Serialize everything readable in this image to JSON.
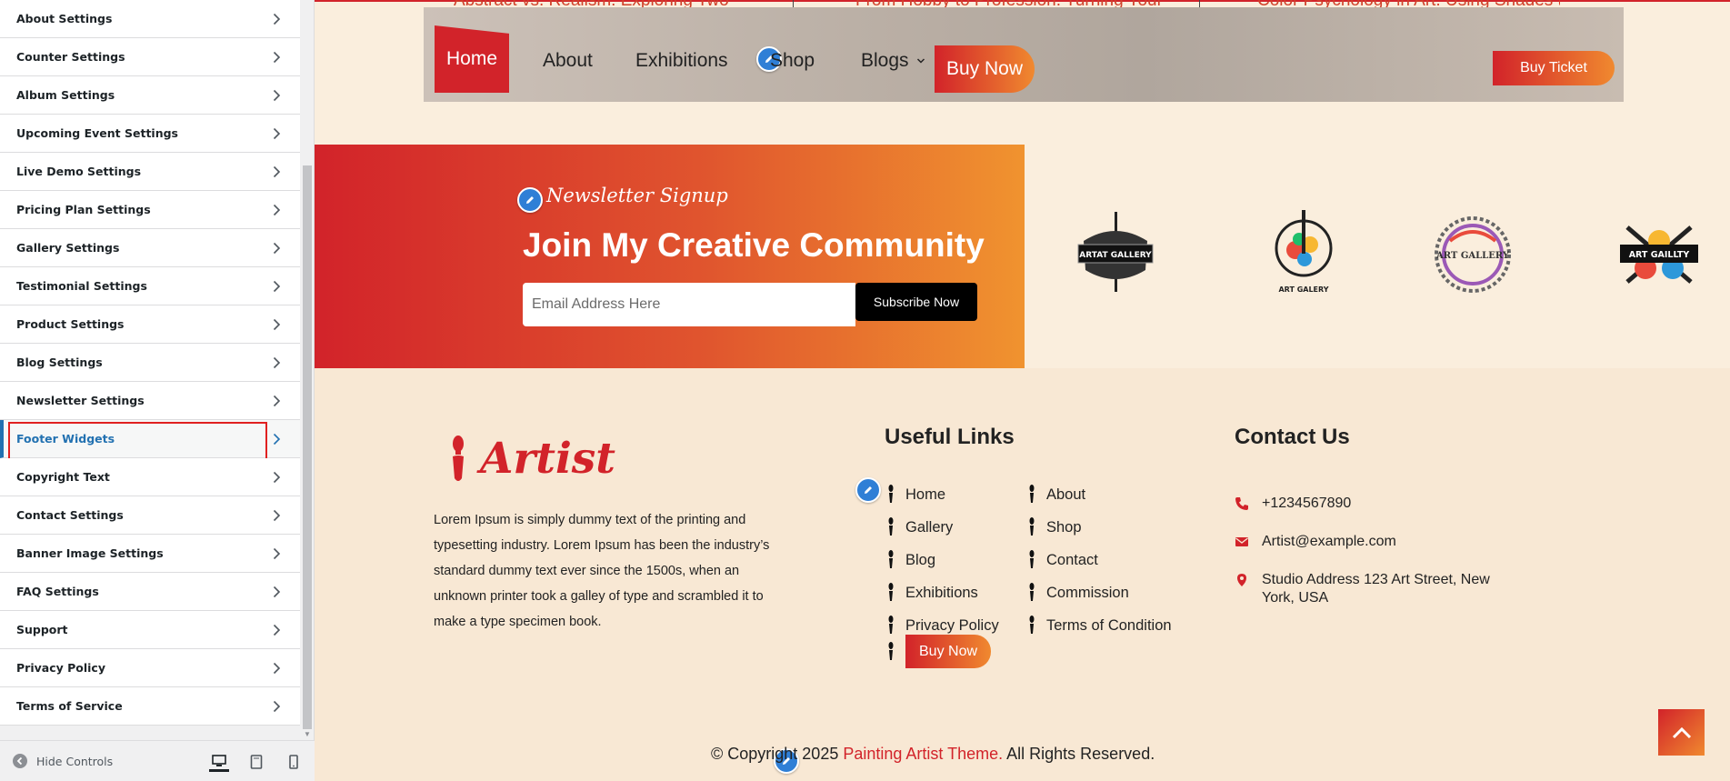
{
  "sidebar": {
    "items": [
      {
        "label": "About Settings"
      },
      {
        "label": "Counter Settings"
      },
      {
        "label": "Album Settings"
      },
      {
        "label": "Upcoming Event Settings"
      },
      {
        "label": "Live Demo Settings"
      },
      {
        "label": "Pricing Plan Settings"
      },
      {
        "label": "Gallery Settings"
      },
      {
        "label": "Testimonial Settings"
      },
      {
        "label": "Product Settings"
      },
      {
        "label": "Blog Settings"
      },
      {
        "label": "Newsletter Settings"
      },
      {
        "label": "Footer Widgets"
      },
      {
        "label": "Copyright Text"
      },
      {
        "label": "Contact Settings"
      },
      {
        "label": "Banner Image Settings"
      },
      {
        "label": "FAQ Settings"
      },
      {
        "label": "Support"
      },
      {
        "label": "Privacy Policy"
      },
      {
        "label": "Terms of Service"
      }
    ],
    "active_item": "Footer Widgets",
    "hide_controls": "Hide Controls",
    "devices": [
      "desktop-icon",
      "tablet-icon",
      "mobile-icon"
    ],
    "accent": "#2271b1"
  },
  "preview": {
    "cut_titles": [
      "Abstract vs. Realism: Exploring Two",
      "From Hobby to Profession: Turning Your",
      "Color Psychology in Art: Using Shades to"
    ],
    "nav": {
      "home": "Home",
      "about": "About",
      "exhibitions": "Exhibitions",
      "shop": "Shop",
      "blogs": "Blogs",
      "buy_now": "Buy Now",
      "buy_ticket": "Buy Ticket"
    },
    "newsletter": {
      "small_title": "Newsletter Signup",
      "title": "Join My Creative Community",
      "email_placeholder": "Email Address Here",
      "subscribe": "Subscribe Now"
    },
    "logos": [
      {
        "text": "ARTAT GALLERY"
      },
      {
        "text": "ART GALERY"
      },
      {
        "text": "ART GALLERY"
      },
      {
        "text": "ART GAILLTY"
      }
    ],
    "footer": {
      "brand": "Artist",
      "description": "Lorem Ipsum is simply dummy text of the printing and typesetting industry. Lorem Ipsum has been the industry’s standard dummy text ever since the 1500s, when an unknown printer took a galley of type and scrambled it to make a type specimen book.",
      "useful_links_heading": "Useful Links",
      "links_left": [
        "Home",
        "Gallery",
        "Blog",
        "Exhibitions",
        "Privacy Policy"
      ],
      "links_right": [
        "About",
        "Shop",
        "Contact",
        "Commission",
        "Terms of Condition"
      ],
      "buy_now": "Buy Now",
      "contact_heading": "Contact Us",
      "phone": "+1234567890",
      "email": "Artist@example.com",
      "address": "Studio Address 123 Art Street, New York, USA",
      "copyright_prefix": "© Copyright 2025",
      "copyright_link": "Painting Artist Theme.",
      "copyright_suffix": "All Rights Reserved."
    },
    "colors": {
      "brand_red": "#d2232a",
      "brand_orange": "#f0892f",
      "edit_blue": "#2f7fd6"
    }
  }
}
